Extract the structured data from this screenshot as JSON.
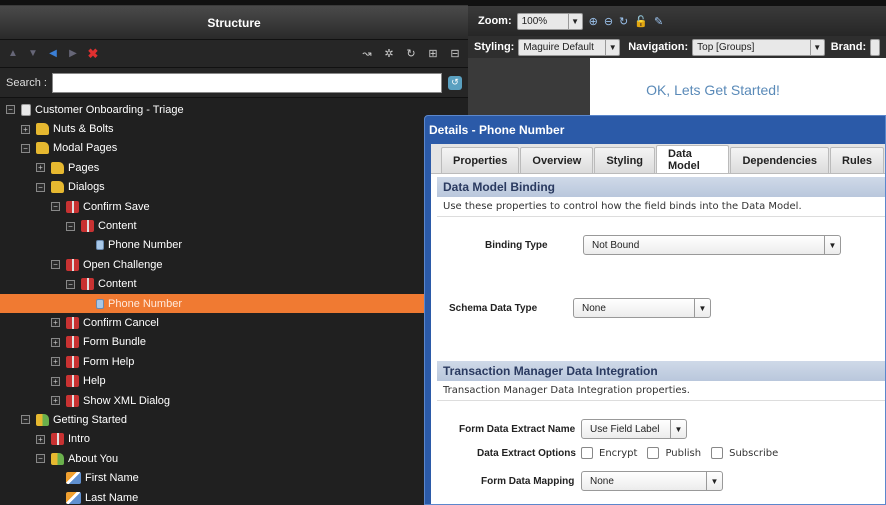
{
  "structure": {
    "title": "Structure",
    "search_label": "Search :",
    "search_value": "",
    "tree": [
      {
        "label": "Customer Onboarding - Triage",
        "indent": 0,
        "pm": "−",
        "icon": "doc"
      },
      {
        "label": "Nuts & Bolts",
        "indent": 1,
        "pm": "+",
        "icon": "folder"
      },
      {
        "label": "Modal Pages",
        "indent": 1,
        "pm": "−",
        "icon": "folder"
      },
      {
        "label": "Pages",
        "indent": 2,
        "pm": "+",
        "icon": "folder"
      },
      {
        "label": "Dialogs",
        "indent": 2,
        "pm": "−",
        "icon": "folder"
      },
      {
        "label": "Confirm Save",
        "indent": 3,
        "pm": "−",
        "icon": "dialog"
      },
      {
        "label": "Content",
        "indent": 4,
        "pm": "−",
        "icon": "dialog"
      },
      {
        "label": "Phone Number",
        "indent": 5,
        "pm": "",
        "icon": "field"
      },
      {
        "label": "Open Challenge",
        "indent": 3,
        "pm": "−",
        "icon": "dialog"
      },
      {
        "label": "Content",
        "indent": 4,
        "pm": "−",
        "icon": "dialog"
      },
      {
        "label": "Phone Number",
        "indent": 5,
        "pm": "",
        "icon": "field",
        "selected": true
      },
      {
        "label": "Confirm Cancel",
        "indent": 3,
        "pm": "+",
        "icon": "dialog"
      },
      {
        "label": "Form Bundle",
        "indent": 3,
        "pm": "+",
        "icon": "dialog"
      },
      {
        "label": "Form Help",
        "indent": 3,
        "pm": "+",
        "icon": "dialog"
      },
      {
        "label": "Help",
        "indent": 3,
        "pm": "+",
        "icon": "dialog"
      },
      {
        "label": "Show XML Dialog",
        "indent": 3,
        "pm": "+",
        "icon": "dialog"
      },
      {
        "label": "Getting Started",
        "indent": 1,
        "pm": "−",
        "icon": "folderg"
      },
      {
        "label": "Intro",
        "indent": 2,
        "pm": "+",
        "icon": "dialog"
      },
      {
        "label": "About You",
        "indent": 2,
        "pm": "−",
        "icon": "folderg"
      },
      {
        "label": "First Name",
        "indent": 3,
        "pm": "",
        "icon": "pencil"
      },
      {
        "label": "Last Name",
        "indent": 3,
        "pm": "",
        "icon": "pencil"
      }
    ]
  },
  "editor": {
    "zoom_label": "Zoom:",
    "zoom_value": "100%",
    "styling_label": "Styling:",
    "styling_value": "Maguire Default",
    "navigation_label": "Navigation:",
    "navigation_value": "Top [Groups]",
    "brand_label": "Brand:",
    "canvas_title": "OK, Lets Get Started!"
  },
  "dialog": {
    "title": "Details - Phone Number",
    "tabs": [
      "Properties",
      "Overview",
      "Styling",
      "Data Model",
      "Dependencies",
      "Rules"
    ],
    "active_tab": "Data Model",
    "section1": {
      "title": "Data Model Binding",
      "desc": "Use these properties to control how the field binds into the Data Model.",
      "binding_type_label": "Binding Type",
      "binding_type_value": "Not Bound",
      "schema_type_label": "Schema Data Type",
      "schema_type_value": "None"
    },
    "section2": {
      "title": "Transaction Manager Data Integration",
      "desc": "Transaction Manager Data Integration properties.",
      "extract_name_label": "Form Data Extract Name",
      "extract_name_value": "Use Field Label",
      "extract_options_label": "Data Extract Options",
      "encrypt": "Encrypt",
      "publish": "Publish",
      "subscribe": "Subscribe",
      "mapping_label": "Form Data Mapping",
      "mapping_value": "None"
    }
  }
}
